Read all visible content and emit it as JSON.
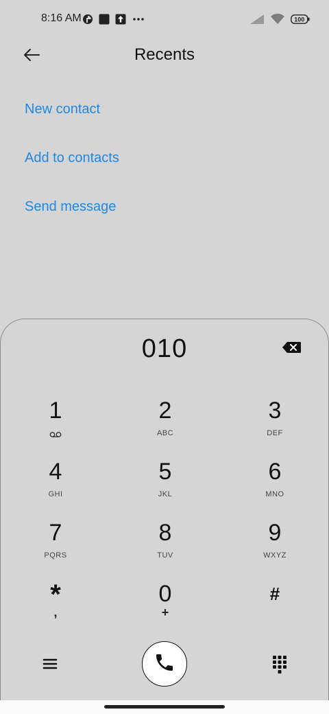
{
  "status_bar": {
    "time": "8:16 AM",
    "battery": "100",
    "icons_left": [
      "app-notification-icon",
      "square-notification-icon",
      "upload-icon",
      "more-dots-icon"
    ],
    "icons_right": [
      "signal-icon",
      "wifi-icon",
      "battery-icon"
    ]
  },
  "header": {
    "title": "Recents",
    "back_icon": "back-arrow-icon"
  },
  "actions": [
    {
      "label": "New contact"
    },
    {
      "label": "Add to contacts"
    },
    {
      "label": "Send message"
    }
  ],
  "colors": {
    "accent": "#1e88e5",
    "background": "#d5d5d5",
    "call_button": "#ffffff"
  },
  "dialer": {
    "number": "010",
    "backspace_icon": "backspace-icon",
    "keys": [
      {
        "digit": "1",
        "letters": "",
        "sub_icon": "voicemail-icon"
      },
      {
        "digit": "2",
        "letters": "ABC"
      },
      {
        "digit": "3",
        "letters": "DEF"
      },
      {
        "digit": "4",
        "letters": "GHI"
      },
      {
        "digit": "5",
        "letters": "JKL"
      },
      {
        "digit": "6",
        "letters": "MNO"
      },
      {
        "digit": "7",
        "letters": "PQRS"
      },
      {
        "digit": "8",
        "letters": "TUV"
      },
      {
        "digit": "9",
        "letters": "WXYZ"
      },
      {
        "digit": "*",
        "letters": ","
      },
      {
        "digit": "0",
        "letters": "+"
      },
      {
        "digit": "#",
        "letters": ""
      }
    ]
  },
  "bottom_bar": {
    "menu_icon": "menu-icon",
    "call_icon": "phone-icon",
    "dialpad_icon": "dialpad-icon"
  }
}
